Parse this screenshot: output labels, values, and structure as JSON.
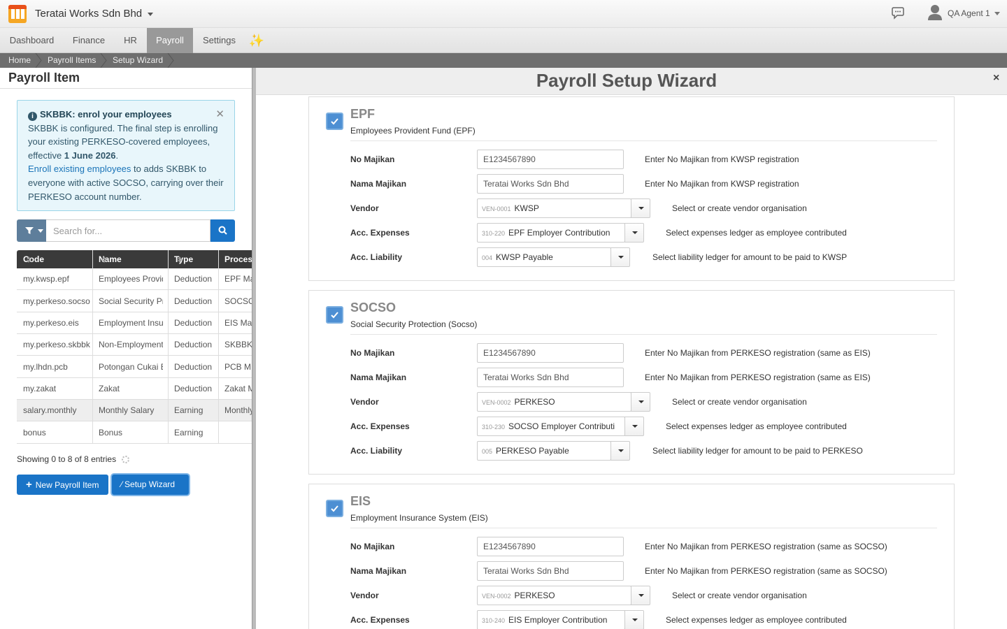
{
  "header": {
    "company": "Teratai Works Sdn Bhd",
    "user": "QA Agent 1"
  },
  "nav": {
    "tabs": [
      "Dashboard",
      "Finance",
      "HR",
      "Payroll",
      "Settings"
    ],
    "active": "Payroll",
    "sparkle": "✨"
  },
  "breadcrumb": [
    "Home",
    "Payroll Items",
    "Setup Wizard"
  ],
  "left_panel": {
    "title": "Payroll Item",
    "alert": {
      "title": "SKBBK: enrol your employees",
      "text1": "SKBBK is configured. The final step is enrolling your existing PERKESO-covered employees, effective ",
      "date": "1 June 2026",
      "text2": ".",
      "link": "Enroll existing employees",
      "text3": " to adds SKBBK to everyone with active SOCSO, carrying over their PERKESO account number."
    },
    "search_placeholder": "Search for...",
    "columns": [
      "Code",
      "Name",
      "Type",
      "Process"
    ],
    "rows": [
      {
        "code": "my.kwsp.epf",
        "name": "Employees Provident Fund",
        "type": "Deduction",
        "process": "EPF Ma"
      },
      {
        "code": "my.perkeso.socso",
        "name": "Social Security Protection",
        "type": "Deduction",
        "process": "SOCSO"
      },
      {
        "code": "my.perkeso.eis",
        "name": "Employment Insurance",
        "type": "Deduction",
        "process": "EIS Ma"
      },
      {
        "code": "my.perkeso.skbbk",
        "name": "Non-Employment Injury",
        "type": "Deduction",
        "process": "SKBBK"
      },
      {
        "code": "my.lhdn.pcb",
        "name": "Potongan Cukai Bulanan",
        "type": "Deduction",
        "process": "PCB M"
      },
      {
        "code": "my.zakat",
        "name": "Zakat",
        "type": "Deduction",
        "process": "Zakat M"
      },
      {
        "code": "salary.monthly",
        "name": "Monthly Salary",
        "type": "Earning",
        "process": "Monthly"
      },
      {
        "code": "bonus",
        "name": "Bonus",
        "type": "Earning",
        "process": ""
      }
    ],
    "showing": "Showing 0 to 8 of 8 entries",
    "new_button": "New Payroll Item",
    "wizard_button": "Setup Wizard"
  },
  "modal": {
    "title": "Payroll Setup Wizard",
    "close": "×",
    "sections": [
      {
        "name": "EPF",
        "subtitle": "Employees Provident Fund (EPF)",
        "checked": true,
        "no_majikan": {
          "label": "No Majikan",
          "value": "E1234567890",
          "help": "Enter No Majikan from KWSP registration"
        },
        "nama_majikan": {
          "label": "Nama Majikan",
          "value": "Teratai Works Sdn Bhd",
          "help": "Enter No Majikan from KWSP registration"
        },
        "vendor": {
          "label": "Vendor",
          "code": "VEN-0001",
          "value": "KWSP",
          "help": "Select or create vendor organisation"
        },
        "expenses": {
          "label": "Acc. Expenses",
          "code": "310-220",
          "value": "EPF Employer Contribution",
          "help": "Select expenses ledger as employee contributed"
        },
        "liability": {
          "label": "Acc. Liability",
          "code": "004",
          "value": "KWSP Payable",
          "help": "Select liability ledger for amount to be paid to KWSP"
        }
      },
      {
        "name": "SOCSO",
        "subtitle": "Social Security Protection (Socso)",
        "checked": true,
        "no_majikan": {
          "label": "No Majikan",
          "value": "E1234567890",
          "help": "Enter No Majikan from PERKESO registration (same as EIS)"
        },
        "nama_majikan": {
          "label": "Nama Majikan",
          "value": "Teratai Works Sdn Bhd",
          "help": "Enter No Majikan from PERKESO registration (same as EIS)"
        },
        "vendor": {
          "label": "Vendor",
          "code": "VEN-0002",
          "value": "PERKESO",
          "help": "Select or create vendor organisation"
        },
        "expenses": {
          "label": "Acc. Expenses",
          "code": "310-230",
          "value": "SOCSO Employer Contribution",
          "help": "Select expenses ledger as employee contributed"
        },
        "liability": {
          "label": "Acc. Liability",
          "code": "005",
          "value": "PERKESO Payable",
          "help": "Select liability ledger for amount to be paid to PERKESO"
        }
      },
      {
        "name": "EIS",
        "subtitle": "Employment Insurance System (EIS)",
        "checked": true,
        "no_majikan": {
          "label": "No Majikan",
          "value": "E1234567890",
          "help": "Enter No Majikan from PERKESO registration (same as SOCSO)"
        },
        "nama_majikan": {
          "label": "Nama Majikan",
          "value": "Teratai Works Sdn Bhd",
          "help": "Enter No Majikan from PERKESO registration (same as SOCSO)"
        },
        "vendor": {
          "label": "Vendor",
          "code": "VEN-0002",
          "value": "PERKESO",
          "help": "Select or create vendor organisation"
        },
        "expenses": {
          "label": "Acc. Expenses",
          "code": "310-240",
          "value": "EIS Employer Contribution",
          "help": "Select expenses ledger as employee contributed"
        }
      }
    ]
  },
  "colors": {
    "accent": "#1a74c7",
    "active_tab": "#999999",
    "checkbox": "#4d8fd3"
  }
}
